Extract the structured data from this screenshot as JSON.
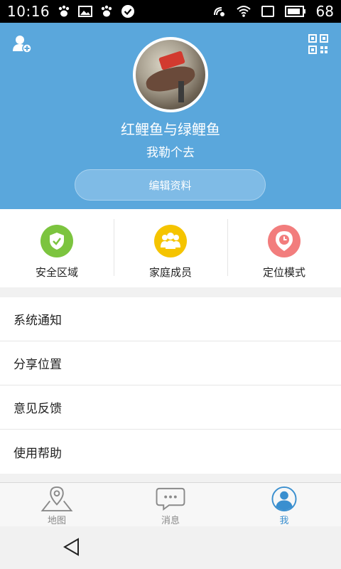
{
  "status_bar": {
    "time": "10:16",
    "battery_text": "68",
    "left_icons": [
      "paw-icon",
      "image-icon",
      "paw-icon",
      "check-circle-icon"
    ],
    "right_icons": [
      "nfc-icon",
      "wifi-icon",
      "sim-icon",
      "battery-icon"
    ]
  },
  "profile": {
    "name": "红鲤鱼与绿鲤鱼",
    "signature": "我勒个去",
    "edit_button_label": "编辑资料",
    "colors": {
      "header_bg": "#5aa7dc"
    }
  },
  "features": [
    {
      "label": "安全区域",
      "icon": "shield-check-icon",
      "color": "#7cc43f"
    },
    {
      "label": "家庭成员",
      "icon": "family-icon",
      "color": "#f5c400"
    },
    {
      "label": "定位模式",
      "icon": "location-clock-icon",
      "color": "#f27d7d"
    }
  ],
  "menu": [
    {
      "label": "系统通知"
    },
    {
      "label": "分享位置"
    },
    {
      "label": "意见反馈"
    },
    {
      "label": "使用帮助"
    }
  ],
  "bottom_nav": [
    {
      "label": "地图",
      "icon": "map-pin-icon",
      "active": false
    },
    {
      "label": "消息",
      "icon": "chat-bubble-icon",
      "active": false
    },
    {
      "label": "我",
      "icon": "user-icon",
      "active": true
    }
  ],
  "colors": {
    "accent": "#3a8fcf"
  }
}
